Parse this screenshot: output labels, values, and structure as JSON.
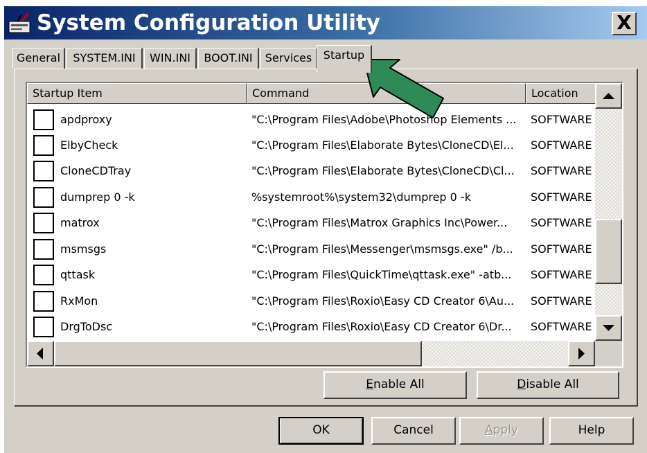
{
  "window": {
    "title": "System Configuration Utility",
    "close_glyph": "X",
    "title_gradient": [
      "#0a246a",
      "#a6caf0"
    ]
  },
  "tabs": [
    {
      "label": "General"
    },
    {
      "label": "SYSTEM.INI"
    },
    {
      "label": "WIN.INI"
    },
    {
      "label": "BOOT.INI"
    },
    {
      "label": "Services"
    },
    {
      "label": "Startup",
      "active": true
    }
  ],
  "list": {
    "columns": [
      "Startup Item",
      "Command",
      "Location"
    ],
    "rows": [
      {
        "checked": false,
        "item": "apdproxy",
        "command": "\"C:\\Program Files\\Adobe\\Photoshop Elements ...",
        "location": "SOFTWARE"
      },
      {
        "checked": false,
        "item": "ElbyCheck",
        "command": "\"C:\\Program Files\\Elaborate Bytes\\CloneCD\\El...",
        "location": "SOFTWARE"
      },
      {
        "checked": false,
        "item": "CloneCDTray",
        "command": "\"C:\\Program Files\\Elaborate Bytes\\CloneCD\\Cl...",
        "location": "SOFTWARE"
      },
      {
        "checked": false,
        "item": "dumprep 0 -k",
        "command": "%systemroot%\\system32\\dumprep 0 -k",
        "location": "SOFTWARE"
      },
      {
        "checked": false,
        "item": "matrox",
        "command": "\"C:\\Program Files\\Matrox Graphics Inc\\Power...",
        "location": "SOFTWARE"
      },
      {
        "checked": false,
        "item": "msmsgs",
        "command": "\"C:\\Program Files\\Messenger\\msmsgs.exe\" /b...",
        "location": "SOFTWARE"
      },
      {
        "checked": false,
        "item": "qttask",
        "command": "\"C:\\Program Files\\QuickTime\\qttask.exe\" -atb...",
        "location": "SOFTWARE"
      },
      {
        "checked": false,
        "item": "RxMon",
        "command": "\"C:\\Program Files\\Roxio\\Easy CD Creator 6\\Au...",
        "location": "SOFTWARE"
      },
      {
        "checked": false,
        "item": "DrgToDsc",
        "command": "\"C:\\Program Files\\Roxio\\Easy CD Creator 6\\Dr...",
        "location": "SOFTWARE"
      }
    ]
  },
  "buttons": {
    "enable_all": {
      "mnemonic": "E",
      "rest": "nable All"
    },
    "disable_all": {
      "mnemonic": "D",
      "rest": "isable All"
    },
    "ok": "OK",
    "cancel": "Cancel",
    "apply": {
      "mnemonic": "A",
      "rest": "pply",
      "disabled": true
    },
    "help": "Help"
  },
  "annotation": {
    "arrow_color": "#2e8b57",
    "points_to": "Startup"
  }
}
